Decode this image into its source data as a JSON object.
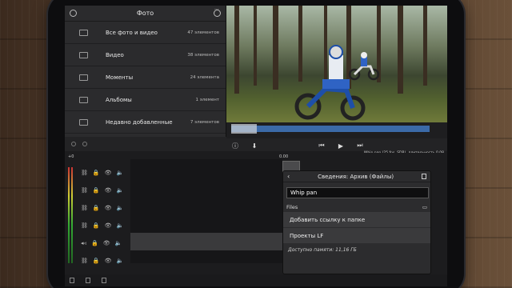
{
  "picker": {
    "title": "Фото",
    "rows": [
      {
        "label": "Все фото и видео",
        "count": "47 элементов",
        "icon": "photo-icon"
      },
      {
        "label": "Видео",
        "count": "38 элементов",
        "icon": "video-icon"
      },
      {
        "label": "Моменты",
        "count": "24 элемента",
        "icon": "moments-icon"
      },
      {
        "label": "Альбомы",
        "count": "1 элемент",
        "icon": "album-icon"
      },
      {
        "label": "Недавно добавленные",
        "count": "7 элементов",
        "icon": "folder-icon"
      }
    ]
  },
  "viewer": {
    "info": "Whip pan (25 fps, SDR), длительность 0.08"
  },
  "transport": {
    "play": "▶",
    "skip": "⏭"
  },
  "timeline": {
    "zero_label": "0.00",
    "plus_label": "+0"
  },
  "popover": {
    "title": "Сведения: Архив (Файлы)",
    "back": "‹",
    "name_value": "Whip pan",
    "section": "Files",
    "items": [
      "Добавить ссылку к папке",
      "Проекты LF"
    ],
    "footer": "Доступно памяти: 11,16 ГБ"
  }
}
